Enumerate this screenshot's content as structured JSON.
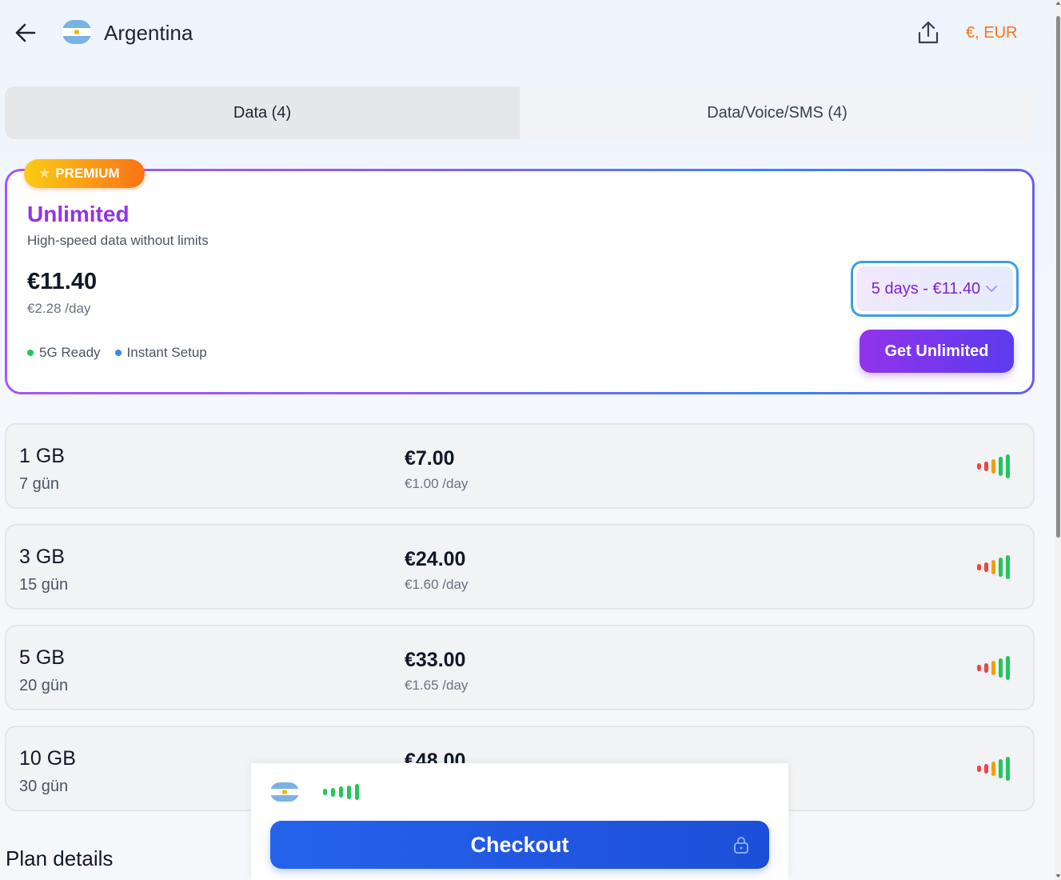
{
  "header": {
    "back_icon": "arrow-left-icon",
    "flag": "argentina-flag",
    "title": "Argentina",
    "share_icon": "share-icon",
    "currency": "€, EUR"
  },
  "tabs": [
    {
      "label": "Data (4)",
      "active": true
    },
    {
      "label": "Data/Voice/SMS (4)",
      "active": false
    }
  ],
  "premium": {
    "badge": "PREMIUM",
    "badge_icon": "star-icon",
    "name": "Unlimited",
    "description": "High-speed data without limits",
    "price": "€11.40",
    "per_day": "€2.28 /day",
    "features": [
      {
        "label": "5G Ready",
        "color": "#22c55e"
      },
      {
        "label": "Instant Setup",
        "color": "#3b82f6"
      }
    ],
    "duration_selected": "5 days - €11.40",
    "cta": "Get Unlimited",
    "accent": "#9333ea"
  },
  "plans": [
    {
      "data": "1 GB",
      "duration": "7 gün",
      "price": "€7.00",
      "per_day": "€1.00 /day"
    },
    {
      "data": "3 GB",
      "duration": "15 gün",
      "price": "€24.00",
      "per_day": "€1.60 /day"
    },
    {
      "data": "5 GB",
      "duration": "20 gün",
      "price": "€33.00",
      "per_day": "€1.65 /day"
    },
    {
      "data": "10 GB",
      "duration": "30 gün",
      "price": "€48.00",
      "per_day": ""
    }
  ],
  "signal_colors": [
    "#ef4444",
    "#ef4444",
    "#f59e0b",
    "#22c55e",
    "#22c55e"
  ],
  "section_title": "Plan details",
  "checkout": {
    "label": "Checkout",
    "lock_icon": "lock-icon",
    "signal_color": "#22c55e",
    "accent": "#2563eb"
  }
}
